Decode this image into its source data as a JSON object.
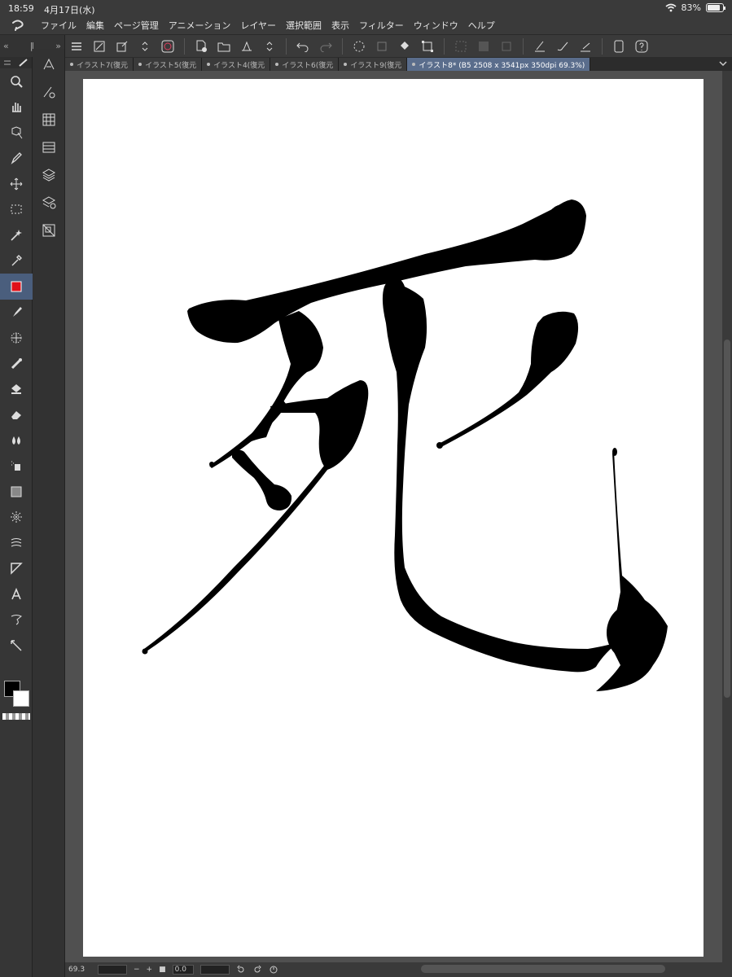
{
  "status": {
    "time": "18:59",
    "date": "4月17日(水)",
    "battery": "83%",
    "battery_level": 0.83
  },
  "menu": [
    "ファイル",
    "編集",
    "ページ管理",
    "アニメーション",
    "レイヤー",
    "選択範囲",
    "表示",
    "フィルター",
    "ウィンドウ",
    "ヘルプ"
  ],
  "toolbar_left": {
    "collapse": "«",
    "grip": "‖",
    "expand": "»"
  },
  "tabs": [
    {
      "label": "イラスト7(復元",
      "active": false
    },
    {
      "label": "イラスト5(復元",
      "active": false
    },
    {
      "label": "イラスト4(復元",
      "active": false
    },
    {
      "label": "イラスト6(復元",
      "active": false
    },
    {
      "label": "イラスト9(復元",
      "active": false
    },
    {
      "label": "イラスト8* (B5 2508 x 3541px 350dpi 69.3%)",
      "active": true
    }
  ],
  "bottom": {
    "zoom": "69.3",
    "minus": "−",
    "plus": "+",
    "angle": "0.0"
  },
  "colors": {
    "main_color": "#000000",
    "sub_color": "#ffffff",
    "active_tool_swatch": "#e0101a",
    "accent": "#5a6d8c"
  },
  "icons": {
    "tools": [
      "zoom-icon",
      "hand-icon",
      "operation-icon",
      "pen-icon",
      "move-icon",
      "selection-icon",
      "auto-select-icon",
      "eyedropper-icon",
      "color-swatch-icon",
      "brush-icon",
      "decoration-icon",
      "blend-icon",
      "fill-icon",
      "eraser-icon",
      "watercolor-icon",
      "airbrush-icon",
      "gradient-icon",
      "figure-icon",
      "frame-icon",
      "ruler-icon",
      "text-icon",
      "balloon-icon",
      "correct-line-icon"
    ]
  }
}
